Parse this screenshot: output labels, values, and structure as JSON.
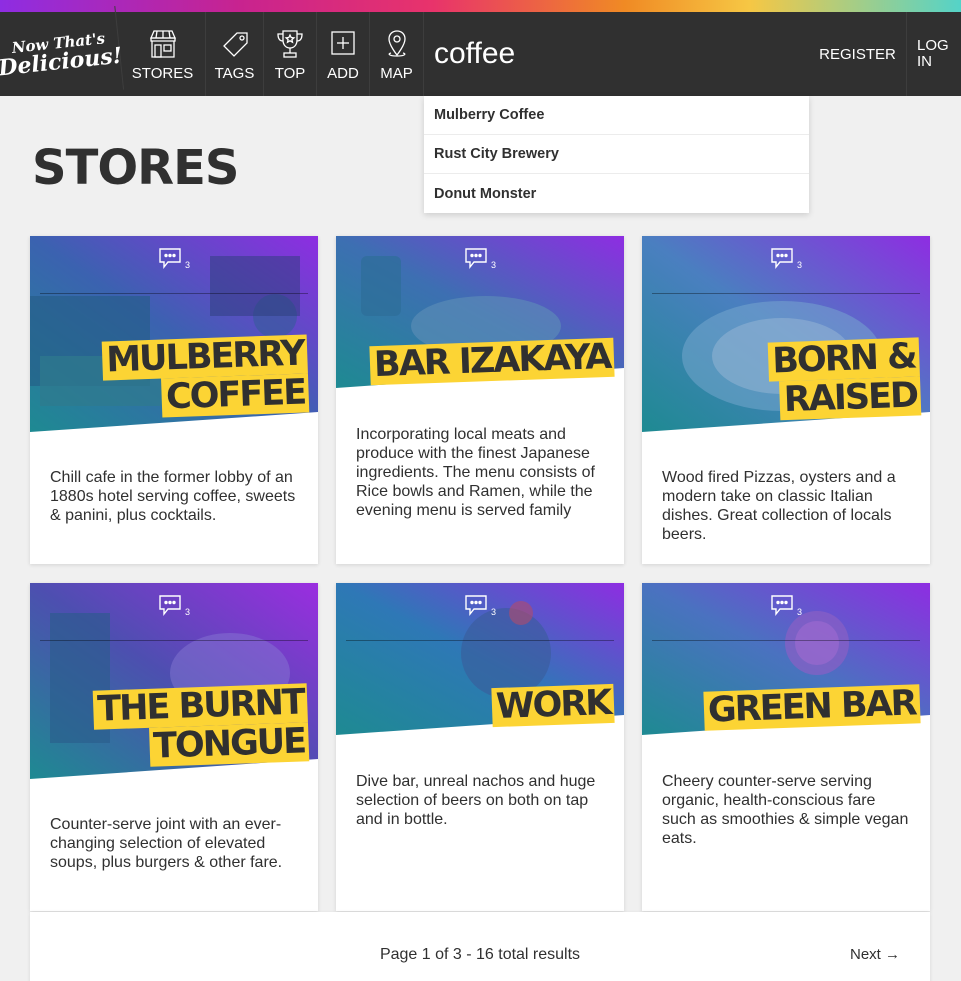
{
  "brand": {
    "line1": "Now That's",
    "line2": "Delicious!"
  },
  "nav": {
    "items": [
      {
        "label": "STORES",
        "icon": "store-icon"
      },
      {
        "label": "TAGS",
        "icon": "tag-icon"
      },
      {
        "label": "TOP",
        "icon": "trophy-icon"
      },
      {
        "label": "ADD",
        "icon": "add-icon"
      },
      {
        "label": "MAP",
        "icon": "map-pin-icon"
      }
    ],
    "search_value": "coffee",
    "register": "REGISTER",
    "login": "LOG IN"
  },
  "search_results": [
    "Mulberry Coffee",
    "Rust City Brewery",
    "Donut Monster"
  ],
  "page": {
    "title": "STORES"
  },
  "stores": [
    {
      "name_lines": [
        "MULBERRY",
        "COFFEE"
      ],
      "reviews": "3",
      "description": "Chill cafe in the former lobby of an 1880s hotel serving coffee, sweets & panini, plus cocktails."
    },
    {
      "name_lines": [
        "BAR IZAKAYA"
      ],
      "reviews": "3",
      "description": "Incorporating local meats and produce with the finest Japanese ingredients. The menu consists of Rice bowls and Ramen, while the evening menu is served family"
    },
    {
      "name_lines": [
        "BORN &",
        "RAISED"
      ],
      "reviews": "3",
      "description": "Wood fired Pizzas, oysters and a modern take on classic Italian dishes. Great collection of locals beers."
    },
    {
      "name_lines": [
        "THE BURNT",
        "TONGUE"
      ],
      "reviews": "3",
      "description": "Counter-serve joint with an ever-changing selection of elevated soups, plus burgers & other fare."
    },
    {
      "name_lines": [
        "WORK"
      ],
      "reviews": "3",
      "description": "Dive bar, unreal nachos and huge selection of beers on both on tap and in bottle."
    },
    {
      "name_lines": [
        "GREEN BAR"
      ],
      "reviews": "3",
      "description": "Cheery counter-serve serving organic, health-conscious fare such as smoothies & simple vegan eats."
    }
  ],
  "pagination": {
    "info": "Page 1 of 3 - 16 total results",
    "next": "Next →"
  },
  "colors": {
    "nav_bg": "#303030",
    "title_highlight": "#fcd434",
    "page_bg": "#f0f0f0"
  }
}
